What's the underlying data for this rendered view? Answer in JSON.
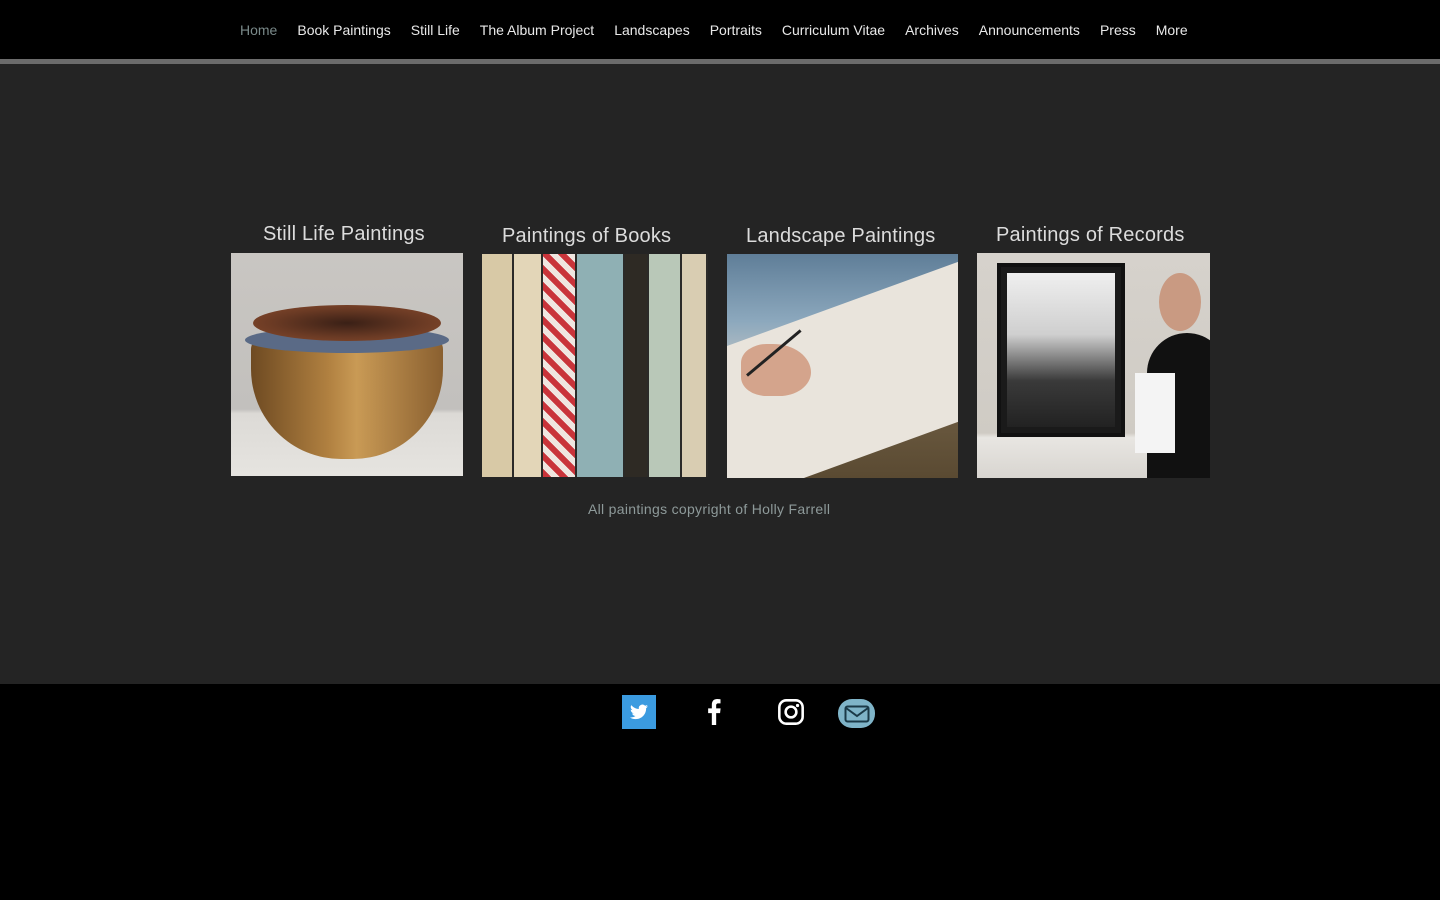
{
  "nav": {
    "items": [
      "Home",
      "Book Paintings",
      "Still Life",
      "The Album Project",
      "Landscapes",
      "Portraits",
      "Curriculum Vitae",
      "Archives",
      "Announcements",
      "Press",
      "More"
    ],
    "active": "Home"
  },
  "gallery": {
    "still_life": "Still Life Paintings",
    "books": "Paintings of Books",
    "landscape": "Landscape Paintings",
    "records": "Paintings of Records"
  },
  "footer": {
    "copyright": "All paintings copyright of Holly Farrell"
  },
  "social": {
    "icons": [
      "twitter-icon",
      "facebook-icon",
      "instagram-icon",
      "mail-icon"
    ]
  },
  "colors": {
    "background_main": "#242424",
    "header_bar": "#6b6b6b",
    "twitter": "#3b9be0",
    "mail": "#7fb4c8"
  }
}
